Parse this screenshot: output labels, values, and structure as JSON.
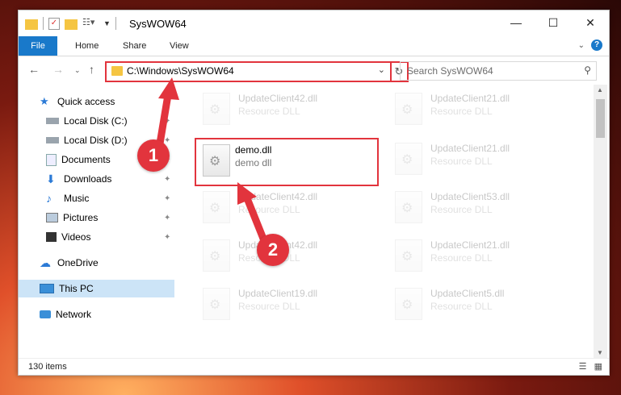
{
  "window": {
    "title": "SysWOW64",
    "controls": {
      "minimize": "—",
      "maximize": "☐",
      "close": "✕"
    }
  },
  "ribbon": {
    "tabs": [
      {
        "label": "File"
      },
      {
        "label": "Home"
      },
      {
        "label": "Share"
      },
      {
        "label": "View"
      }
    ]
  },
  "navigation": {
    "address": "C:\\Windows\\SysWOW64",
    "search_placeholder": "Search SysWOW64"
  },
  "sidebar": {
    "items": [
      {
        "label": "Quick access",
        "icon": "star-icon"
      },
      {
        "label": "Local Disk (C:)",
        "icon": "drive-icon",
        "pinned": true
      },
      {
        "label": "Local Disk (D:)",
        "icon": "drive-icon",
        "pinned": true
      },
      {
        "label": "Documents",
        "icon": "documents-icon",
        "pinned": true
      },
      {
        "label": "Downloads",
        "icon": "downloads-icon",
        "pinned": true
      },
      {
        "label": "Music",
        "icon": "music-icon",
        "pinned": true
      },
      {
        "label": "Pictures",
        "icon": "pictures-icon",
        "pinned": true
      },
      {
        "label": "Videos",
        "icon": "videos-icon",
        "pinned": true
      },
      {
        "label": "OneDrive",
        "icon": "onedrive-icon"
      },
      {
        "label": "This PC",
        "icon": "pc-icon",
        "selected": true
      },
      {
        "label": "Network",
        "icon": "network-icon"
      }
    ]
  },
  "files": {
    "left": [
      {
        "name": "UpdateClient42.dll",
        "type": "Resource DLL"
      },
      {
        "name": "demo.dll",
        "type": "demo dll"
      },
      {
        "name": "UpdateClient42.dll",
        "type": "Resource DLL"
      },
      {
        "name": "UpdateClient42.dll",
        "type": "Resource DLL"
      },
      {
        "name": "UpdateClient19.dll",
        "type": "Resource DLL"
      }
    ],
    "right": [
      {
        "name": "UpdateClient21.dll",
        "type": "Resource DLL"
      },
      {
        "name": "UpdateClient21.dll",
        "type": "Resource DLL"
      },
      {
        "name": "UpdateClient53.dll",
        "type": "Resource DLL"
      },
      {
        "name": "UpdateClient21.dll",
        "type": "Resource DLL"
      },
      {
        "name": "UpdateClient5.dll",
        "type": "Resource DLL"
      }
    ]
  },
  "status": {
    "item_count": "130 items"
  },
  "annotations": {
    "step1": "1",
    "step2": "2",
    "color": "#e2343d"
  }
}
